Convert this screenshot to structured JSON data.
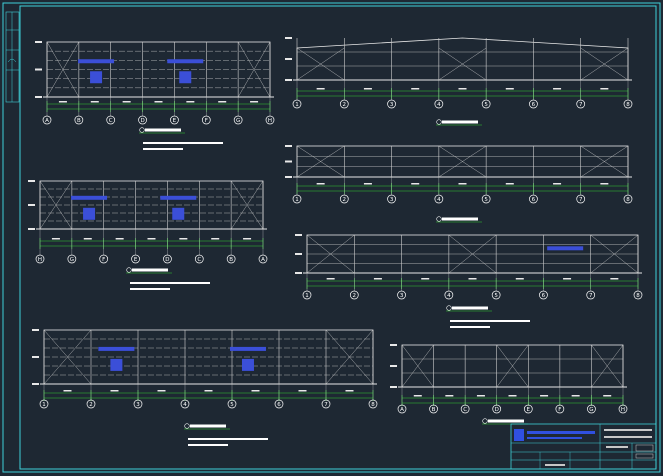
{
  "colors": {
    "background": "#1e2833",
    "frame": "#3fd0d8",
    "grid_line": "#e8e8e8",
    "member": "#d0d0d0",
    "dimension": "#33cc33",
    "axis_bubble": "#ffffff",
    "title_bar": "#ffffff",
    "title_underline": "#33cc33",
    "annotation_blue": "#3b4fd8",
    "title_block_blue": "#3050e0"
  },
  "drawings": [
    {
      "id": "elev-a",
      "kind": "elevation",
      "axis_labels": [
        "A",
        "B",
        "C",
        "D",
        "E",
        "F",
        "G",
        "H"
      ]
    },
    {
      "id": "elev-1",
      "kind": "portal-frame",
      "axis_labels": [
        "1",
        "2",
        "3",
        "4",
        "5",
        "6",
        "7",
        "8"
      ]
    },
    {
      "id": "elev-2",
      "kind": "flat-frame",
      "axis_labels": [
        "1",
        "2",
        "3",
        "4",
        "5",
        "6",
        "7",
        "8"
      ]
    },
    {
      "id": "elev-3",
      "kind": "elevation",
      "axis_labels": [
        "H",
        "G",
        "F",
        "E",
        "D",
        "C",
        "B",
        "A"
      ]
    },
    {
      "id": "elev-4",
      "kind": "purlin",
      "axis_labels": [
        "1",
        "2",
        "3",
        "4",
        "5",
        "6",
        "7",
        "8"
      ]
    },
    {
      "id": "elev-5",
      "kind": "elevation",
      "axis_labels": [
        "1",
        "2",
        "3",
        "4",
        "5",
        "6",
        "7",
        "8"
      ]
    },
    {
      "id": "elev-6",
      "kind": "gable",
      "axis_labels": [
        "A",
        "B",
        "C",
        "D",
        "E",
        "F",
        "G",
        "H"
      ]
    }
  ]
}
